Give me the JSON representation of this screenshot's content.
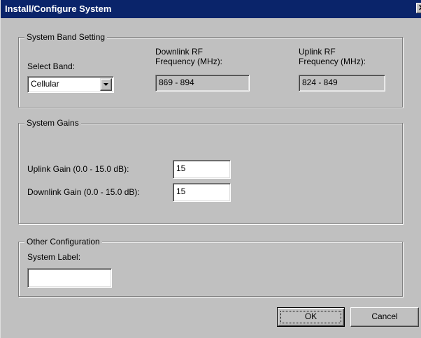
{
  "window": {
    "title": "Install/Configure System",
    "close_glyph": "✕"
  },
  "band_group": {
    "legend": "System Band Setting",
    "select_band_label": "Select Band:",
    "select_band_value": "Cellular",
    "downlink_label_line1": "Downlink RF",
    "downlink_label_line2": "Frequency (MHz):",
    "downlink_value": "869 - 894",
    "uplink_label_line1": "Uplink RF",
    "uplink_label_line2": "Frequency (MHz):",
    "uplink_value": "824 - 849"
  },
  "gains_group": {
    "legend": "System Gains",
    "uplink_gain_label": "Uplink Gain (0.0 - 15.0 dB):",
    "uplink_gain_value": "15",
    "downlink_gain_label": "Downlink Gain (0.0 - 15.0 dB):",
    "downlink_gain_value": "15"
  },
  "other_group": {
    "legend": "Other Configuration",
    "system_label_label": "System Label:",
    "system_label_value": ""
  },
  "buttons": {
    "ok": "OK",
    "cancel": "Cancel"
  },
  "icons": {
    "dropdown": "chevron-down-icon",
    "close": "close-icon"
  },
  "colors": {
    "titlebar": "#0a246a",
    "face": "#c0c0c0"
  }
}
